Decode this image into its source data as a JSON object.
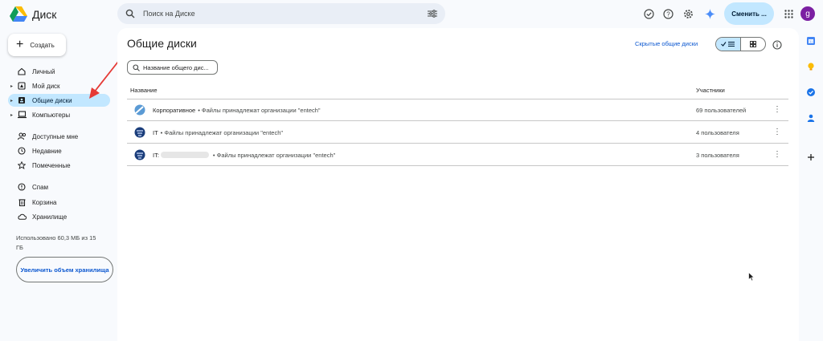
{
  "app": {
    "title": "Диск"
  },
  "search": {
    "placeholder": "Поиск на Диске"
  },
  "header": {
    "switch_label": "Сменить ...",
    "avatar_letter": "g"
  },
  "sidebar": {
    "create_label": "Создать",
    "items": [
      {
        "label": "Личный"
      },
      {
        "label": "Мой диск"
      },
      {
        "label": "Общие диски"
      },
      {
        "label": "Компьютеры"
      },
      {
        "label": "Доступные мне"
      },
      {
        "label": "Недавние"
      },
      {
        "label": "Помеченные"
      },
      {
        "label": "Спам"
      },
      {
        "label": "Корзина"
      },
      {
        "label": "Хранилище"
      }
    ],
    "storage_text": "Использовано 60,3 МБ из 15 ГБ",
    "storage_button": "Увеличить объем хранилища"
  },
  "main": {
    "title": "Общие диски",
    "hidden_link": "Скрытые общие диски",
    "filter_placeholder": "Название общего дис...",
    "columns": {
      "name": "Название",
      "members": "Участники"
    },
    "rows": [
      {
        "name": "Корпоративное",
        "owner": "• Файлы принадлежат организации \"entech\"",
        "members": "69 пользователей"
      },
      {
        "name": "IT",
        "owner": "• Файлы принадлежат организации \"entech\"",
        "members": "4 пользователя"
      },
      {
        "name": "IT:",
        "owner": "• Файлы принадлежат организации \"entech\"",
        "members": "3 пользователя"
      }
    ]
  },
  "colors": {
    "accent": "#0b57d0",
    "active_bg": "#c2e7ff",
    "avatar": "#7b1fa2",
    "annotation_arrow": "#e53935"
  }
}
